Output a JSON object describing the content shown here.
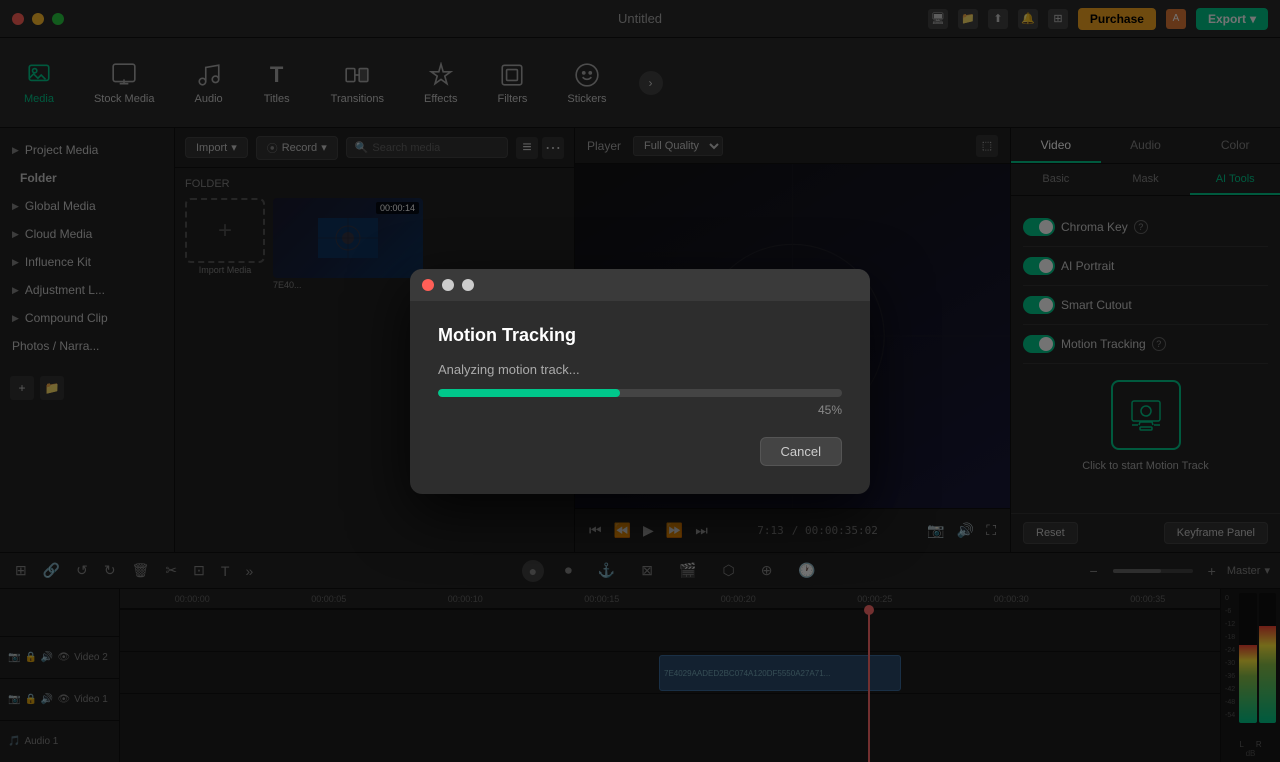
{
  "app": {
    "title": "Untitled"
  },
  "titlebar": {
    "traffic_lights": [
      "red",
      "yellow",
      "green"
    ],
    "purchase_label": "Purchase",
    "export_label": "Export"
  },
  "toolbar": {
    "items": [
      {
        "id": "media",
        "label": "Media",
        "icon": "🖼",
        "active": true
      },
      {
        "id": "stock-media",
        "label": "Stock Media",
        "icon": "🎬",
        "active": false
      },
      {
        "id": "audio",
        "label": "Audio",
        "icon": "🎵",
        "active": false
      },
      {
        "id": "titles",
        "label": "Titles",
        "icon": "T",
        "active": false
      },
      {
        "id": "transitions",
        "label": "Transitions",
        "icon": "⬛",
        "active": false
      },
      {
        "id": "effects",
        "label": "Effects",
        "icon": "✨",
        "active": false
      },
      {
        "id": "filters",
        "label": "Filters",
        "icon": "🔲",
        "active": false
      },
      {
        "id": "stickers",
        "label": "Stickers",
        "icon": "⭐",
        "active": false
      }
    ],
    "more_icon": "›"
  },
  "sidebar": {
    "items": [
      {
        "label": "Project Media",
        "level": 0
      },
      {
        "label": "Folder",
        "level": 1
      },
      {
        "label": "Global Media",
        "level": 0
      },
      {
        "label": "Cloud Media",
        "level": 0
      },
      {
        "label": "Influence Kit",
        "level": 0
      },
      {
        "label": "Adjustment L...",
        "level": 0
      },
      {
        "label": "Compound Clip",
        "level": 0
      },
      {
        "label": "Photos / Narra...",
        "level": 0
      }
    ]
  },
  "media_panel": {
    "import_label": "Import",
    "record_label": "Record",
    "search_placeholder": "Search media",
    "folder_label": "FOLDER",
    "import_media_label": "Import Media",
    "media_item": {
      "name": "7E40...",
      "duration": "00:00:14"
    }
  },
  "preview": {
    "player_label": "Player",
    "quality_label": "Full Quality",
    "timecode_current": "7:13",
    "timecode_total": "/ 00:00:35:02"
  },
  "right_panel": {
    "tabs": [
      "Video",
      "Audio",
      "Color"
    ],
    "active_tab": "Video",
    "subtabs": [
      "Basic",
      "Mask",
      "AI Tools"
    ],
    "active_subtab": "AI Tools",
    "ai_tools": [
      {
        "label": "Chroma Key",
        "on": true,
        "has_info": true
      },
      {
        "label": "AI Portrait",
        "on": true,
        "has_info": false
      },
      {
        "label": "Smart Cutout",
        "on": true,
        "has_info": false
      },
      {
        "label": "Motion Tracking",
        "on": true,
        "has_info": true
      }
    ],
    "motion_track_cta": "Click to start Motion Track",
    "reset_label": "Reset",
    "keyframe_label": "Keyframe Panel"
  },
  "timeline": {
    "ruler_ticks": [
      "00:00:00",
      "00:00:05",
      "00:00:10",
      "00:00:15",
      "00:00:20",
      "00:00:25",
      "00:00:30",
      "00:00:35"
    ],
    "tracks": [
      {
        "label": "Video 2",
        "icons": [
          "cam",
          "lock",
          "sound",
          "eye"
        ]
      },
      {
        "label": "Video 1",
        "icons": [
          "cam",
          "lock",
          "sound",
          "eye"
        ]
      }
    ],
    "master_label": "Master",
    "playhead_position": "68%",
    "clip_label": "7E4029AADED2BC074A120DF5550A27A71...",
    "vu": {
      "labels": [
        "-6",
        "-12",
        "-18",
        "-24",
        "-30",
        "-36",
        "-42",
        "-48",
        "-54"
      ],
      "db_label": "dB",
      "lr_labels": [
        "L",
        "R"
      ]
    }
  },
  "modal": {
    "title": "Motion Tracking",
    "status": "Analyzing motion track...",
    "progress_percent": 45,
    "cancel_label": "Cancel"
  }
}
